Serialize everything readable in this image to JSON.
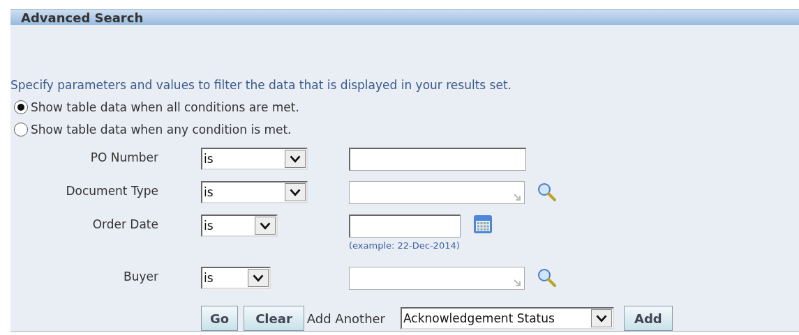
{
  "panel": {
    "title": "Advanced Search"
  },
  "instructions": "Specify parameters and values to filter the data that is displayed in your results set.",
  "match_options": [
    {
      "label": "Show table data when all conditions are met.",
      "selected": true
    },
    {
      "label": "Show table data when any condition is met.",
      "selected": false
    }
  ],
  "conditions": [
    {
      "label": "PO Number",
      "operator": "is",
      "kind": "text"
    },
    {
      "label": "Document Type",
      "operator": "is",
      "kind": "lookup"
    },
    {
      "label": "Order Date",
      "operator": "is",
      "kind": "date",
      "hint": "(example: 22-Dec-2014)"
    },
    {
      "label": "Buyer",
      "operator": "is",
      "kind": "lookup"
    }
  ],
  "actions": {
    "go": "Go",
    "clear": "Clear",
    "add_another_label": "Add Another",
    "add_another_value": "Acknowledgement Status",
    "add": "Add"
  }
}
